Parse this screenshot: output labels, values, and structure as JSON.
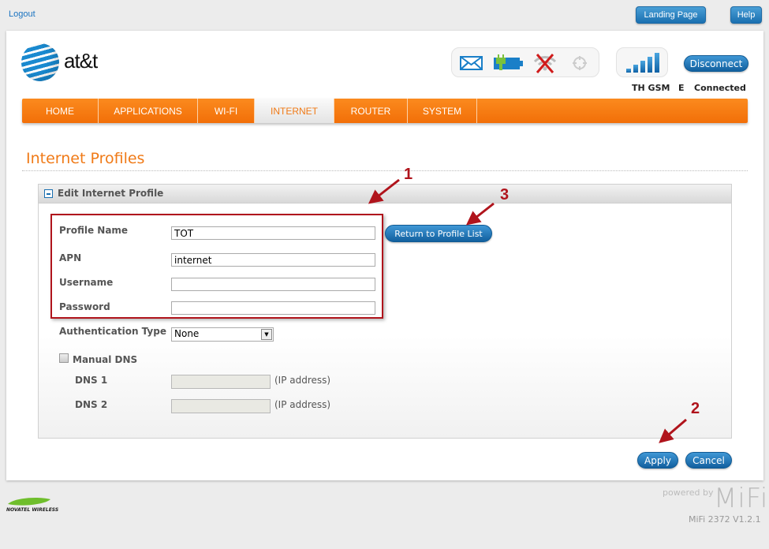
{
  "top": {
    "logout": "Logout",
    "landing_page": "Landing Page",
    "help": "Help"
  },
  "brand": {
    "name": "at&t"
  },
  "status": {
    "icons": [
      "envelope-icon",
      "battery-charging-icon",
      "wifi-disabled-icon",
      "gps-icon"
    ],
    "signal_bars": 5,
    "disconnect": "Disconnect",
    "carrier": "TH GSM",
    "network_type": "E",
    "connection": "Connected"
  },
  "nav": {
    "items": [
      {
        "label": "HOME"
      },
      {
        "label": "APPLICATIONS"
      },
      {
        "label": "WI-FI"
      },
      {
        "label": "INTERNET",
        "active": true
      },
      {
        "label": "ROUTER"
      },
      {
        "label": "SYSTEM"
      }
    ]
  },
  "page": {
    "title": "Internet Profiles"
  },
  "panel": {
    "title": "Edit Internet Profile",
    "return_button": "Return to Profile List",
    "fields": {
      "profile_name": {
        "label": "Profile Name",
        "value": "TOT"
      },
      "apn": {
        "label": "APN",
        "value": "internet"
      },
      "username": {
        "label": "Username",
        "value": ""
      },
      "password": {
        "label": "Password",
        "value": ""
      }
    },
    "auth": {
      "label": "Authentication Type",
      "value": "None"
    },
    "manual_dns": {
      "label": "Manual DNS",
      "checked": false
    },
    "dns1": {
      "label": "DNS 1",
      "value": "",
      "note": "(IP address)"
    },
    "dns2": {
      "label": "DNS 2",
      "value": "",
      "note": "(IP address)"
    }
  },
  "actions": {
    "apply": "Apply",
    "cancel": "Cancel"
  },
  "annotations": {
    "one": "1",
    "two": "2",
    "three": "3"
  },
  "footer": {
    "vendor": "NOVATEL WIRELESS",
    "powered_by": "powered by",
    "brand": "MiFi",
    "version": "MiFi 2372 V1.2.1"
  },
  "colors": {
    "accent": "#f07a17",
    "button_blue": "#1a6fb0",
    "annotation_red": "#b0141c"
  }
}
